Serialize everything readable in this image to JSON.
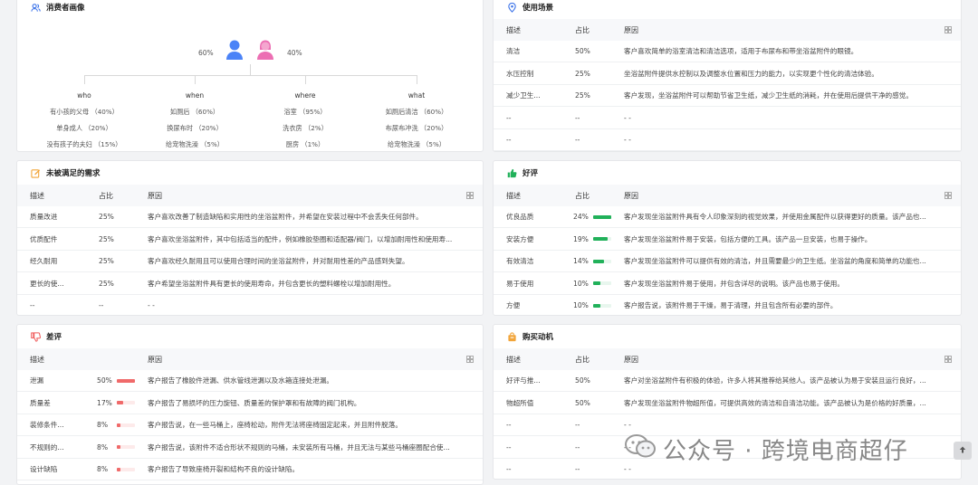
{
  "persona": {
    "title": "消费者画像",
    "male_pct": "60%",
    "female_pct": "40%",
    "columns": [
      {
        "title": "who",
        "items": [
          "有小孩的父母 （40%）",
          "单身成人 （20%）",
          "没有孩子的夫妇 （15%）"
        ]
      },
      {
        "title": "when",
        "items": [
          "如厕后 （60%）",
          "换尿布时 （20%）",
          "给宠物洗澡 （5%）"
        ]
      },
      {
        "title": "where",
        "items": [
          "浴室 （95%）",
          "洗衣房 （2%）",
          "厨房 （1%）"
        ]
      },
      {
        "title": "what",
        "items": [
          "如厕后清洁 （60%）",
          "布尿布冲洗 （20%）",
          "给宠物洗澡 （5%）"
        ]
      }
    ]
  },
  "usage": {
    "title": "使用场景",
    "headers": [
      "描述",
      "占比",
      "原因"
    ],
    "rows": [
      [
        "清洁",
        "50%",
        "客户喜欢简单的浴室清洁和清洁选项，适用于布尿布和带坐浴盆附件的眼镜。"
      ],
      [
        "水压控制",
        "25%",
        "坐浴盆附件提供水控制以及调整水位置和压力的能力，以实现更个性化的清洁体验。"
      ],
      [
        "减少卫生...",
        "25%",
        "客户发现，坐浴盆附件可以帮助节省卫生纸，减少卫生纸的消耗，并在使用后提供干净的感觉。"
      ],
      [
        "--",
        "--",
        "- -"
      ],
      [
        "--",
        "--",
        "- -"
      ]
    ]
  },
  "unmet": {
    "title": "未被满足的需求",
    "headers": [
      "描述",
      "占比",
      "原因"
    ],
    "rows": [
      [
        "质量改进",
        "25%",
        "客户喜欢改善了制造缺陷和实用性的坐浴盆附件，并希望在安装过程中不会丢失任何部件。"
      ],
      [
        "优质配件",
        "25%",
        "客户喜欢坐浴盆附件，其中包括适当的配件，例如橡胶垫圈和适配器/阀门，以增加耐用性和使用寿..."
      ],
      [
        "经久耐用",
        "25%",
        "客户喜欢经久耐用且可以使用合理时间的坐浴盆附件，并对耐用性差的产品感到失望。"
      ],
      [
        "更长的使...",
        "25%",
        "客户希望坐浴盆附件具有更长的使用寿命，并包含更长的塑料螺栓以增加耐用性。"
      ],
      [
        "--",
        "--",
        "- -"
      ]
    ]
  },
  "good": {
    "title": "好评",
    "headers": [
      "描述",
      "占比",
      "原因"
    ],
    "bar_color": "#21b15a",
    "rows": [
      {
        "desc": "优良品质",
        "pct": "24%",
        "value": 24,
        "reason": "客户发现坐浴盆附件具有令人印象深刻的视觉效果，并使用金属配件以获得更好的质量。该产品也..."
      },
      {
        "desc": "安装方便",
        "pct": "19%",
        "value": 19,
        "reason": "客户发现坐浴盆附件易于安装，包括方便的工具。该产品一旦安装，也易于操作。"
      },
      {
        "desc": "有效清洁",
        "pct": "14%",
        "value": 14,
        "reason": "客户发现坐浴盆附件可以提供有效的清洁，并且需要最少的卫生纸。坐浴盆的角度和简单的功能也..."
      },
      {
        "desc": "易于使用",
        "pct": "10%",
        "value": 10,
        "reason": "客户发现坐浴盆附件易于使用，并包含详尽的说明。该产品也易于使用。"
      },
      {
        "desc": "方便",
        "pct": "10%",
        "value": 10,
        "reason": "客户报告说，该附件易于干燥，易于清理，并且包含所有必要的部件。"
      }
    ]
  },
  "bad": {
    "title": "差评",
    "headers": [
      "描述",
      "原因"
    ],
    "bar_color": "#f06a6a",
    "rows": [
      {
        "desc": "泄漏",
        "pct": "50%",
        "value": 50,
        "reason": "客户报告了橡胶件泄漏、供水管线泄漏以及水箱连接处泄漏。"
      },
      {
        "desc": "质量差",
        "pct": "17%",
        "value": 17,
        "reason": "客户报告了易损坏的压力旋钮、质量差的保护罩和有故障的阀门机构。"
      },
      {
        "desc": "装修条件...",
        "pct": "8%",
        "value": 8,
        "reason": "客户报告说，在一些马桶上，座椅松动，附件无法将座椅固定起来，并且附件脱落。"
      },
      {
        "desc": "不规则的...",
        "pct": "8%",
        "value": 8,
        "reason": "客户报告说，该附件不适合形状不规则的马桶，未安装所有马桶，并且无法与某些马桶座圈配合使..."
      },
      {
        "desc": "设计缺陷",
        "pct": "8%",
        "value": 8,
        "reason": "客户报告了导致座椅开裂和结构不良的设计缺陷。"
      }
    ]
  },
  "motive": {
    "title": "购买动机",
    "headers": [
      "描述",
      "占比",
      "原因"
    ],
    "rows": [
      [
        "好评与推...",
        "50%",
        "客户对坐浴盆附件有积极的体验，许多人将其推荐给其他人。该产品被认为易于安装且运行良好，..."
      ],
      [
        "物超所值",
        "50%",
        "客户发现坐浴盆附件物超所值，可提供高效的清洁和自清洁功能。该产品被认为是价格的好质量，..."
      ],
      [
        "--",
        "--",
        "- -"
      ],
      [
        "--",
        "--",
        "- -"
      ],
      [
        "--",
        "--",
        "- -"
      ]
    ]
  },
  "watermark": {
    "text": "公众号 · 跨境电商超仔"
  },
  "colors": {
    "male": "#4b83f7",
    "female": "#ec6fb3",
    "accent_blue": "#3c73e9",
    "accent_green": "#21b15a",
    "accent_red": "#ef5757",
    "accent_orange": "#f2a53a"
  }
}
